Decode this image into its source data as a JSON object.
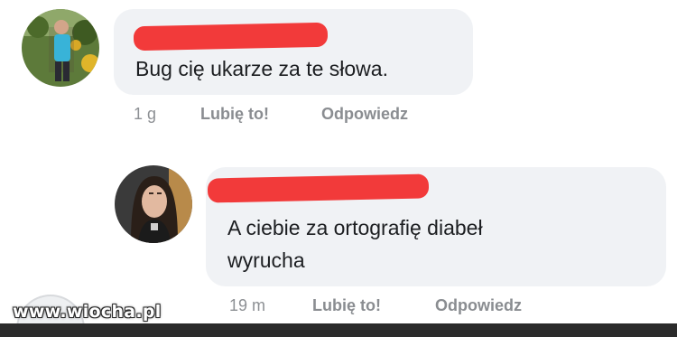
{
  "comments": [
    {
      "text": "Bug cię ukarze za te słowa.",
      "time": "1 g",
      "like_label": "Lubię to!",
      "reply_label": "Odpowiedz"
    },
    {
      "text_line1": "A ciebie za ortografię diabeł",
      "text_line2": "wyrucha",
      "time": "19 m",
      "like_label": "Lubię to!",
      "reply_label": "Odpowiedz"
    }
  ],
  "watermark": "www.wiocha.pl",
  "colors": {
    "bubble": "#f0f2f5",
    "redaction": "#f23a3a",
    "meta_text": "#8a8d91"
  }
}
